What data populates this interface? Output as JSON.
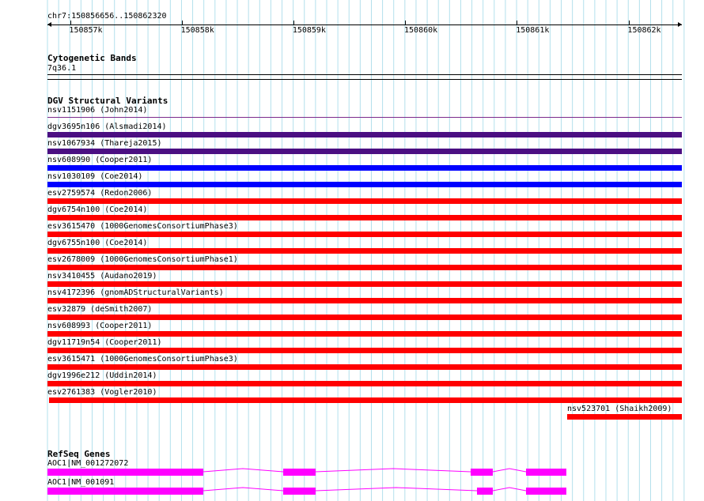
{
  "ruler": {
    "locus": "chr7:150856656..150862320",
    "ticks": [
      "150857k",
      "150858k",
      "150859k",
      "150860k",
      "150861k",
      "150862k"
    ]
  },
  "cytobands": {
    "title": "Cytogenetic Bands",
    "band": "7q36.1"
  },
  "dgv": {
    "title": "DGV Structural Variants",
    "variants": [
      {
        "label": "nsv1151906 (John2014)",
        "color": "#7b2a8c"
      },
      {
        "label": "dgv3695n106 (Alsmadi2014)",
        "color": "#4b0f82"
      },
      {
        "label": "nsv1067934 (Thareja2015)",
        "color": "#4b0f82"
      },
      {
        "label": "nsv608990 (Cooper2011)",
        "color": "#0000ff"
      },
      {
        "label": "nsv1030109 (Coe2014)",
        "color": "#0000ff"
      },
      {
        "label": "esv2759574 (Redon2006)",
        "color": "#ff0000"
      },
      {
        "label": "dgv6754n100 (Coe2014)",
        "color": "#ff0000"
      },
      {
        "label": "esv3615470 (1000GenomesConsortiumPhase3)",
        "color": "#ff0000"
      },
      {
        "label": "dgv6755n100 (Coe2014)",
        "color": "#ff0000"
      },
      {
        "label": "esv2678009 (1000GenomesConsortiumPhase1)",
        "color": "#ff0000"
      },
      {
        "label": "nsv3410455 (Audano2019)",
        "color": "#ff0000"
      },
      {
        "label": "nsv4172396 (gnomADStructuralVariants)",
        "color": "#ff0000"
      },
      {
        "label": "esv32879 (deSmith2007)",
        "color": "#ff0000"
      },
      {
        "label": "nsv608993 (Cooper2011)",
        "color": "#ff0000"
      },
      {
        "label": "dgv11719n54 (Cooper2011)",
        "color": "#ff0000"
      },
      {
        "label": "esv3615471 (1000GenomesConsortiumPhase3)",
        "color": "#ff0000"
      },
      {
        "label": "dgv1996e212 (Uddin2014)",
        "color": "#ff0000"
      },
      {
        "label": "esv2761383 (Vogler2010)",
        "color": "#ff0000"
      },
      {
        "label": "nsv523701 (Shaikh2009)",
        "color": "#ff0000"
      }
    ]
  },
  "refseq": {
    "title": "RefSeq Genes",
    "color": "#ff00ff",
    "genes": [
      {
        "label": "AOC1|NM_001272072"
      },
      {
        "label": "AOC1|NM_001091"
      }
    ]
  }
}
